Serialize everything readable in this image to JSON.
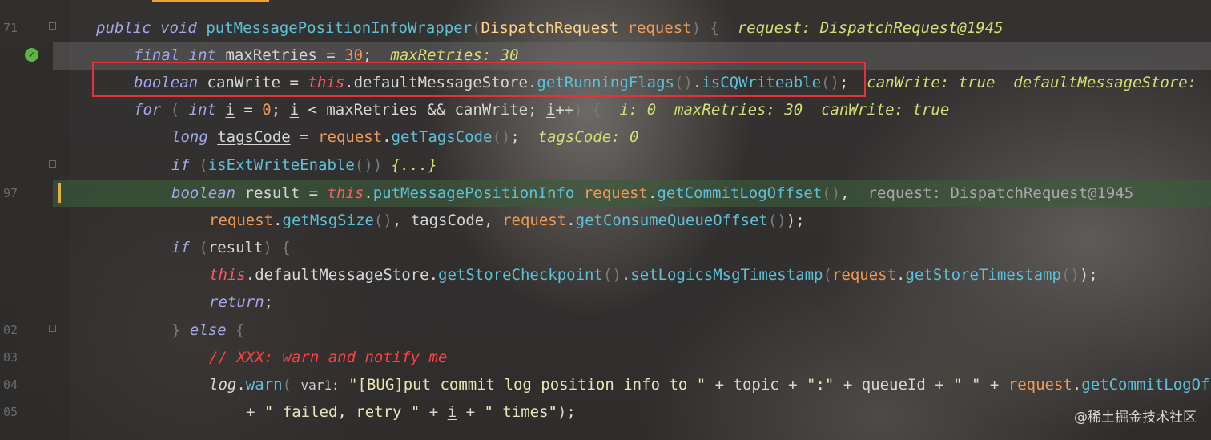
{
  "gutter": {
    "line_numbers": [
      "71",
      "",
      "",
      "",
      "",
      "",
      "97",
      "",
      "",
      "",
      "",
      "02",
      "03",
      "04",
      "05"
    ],
    "line_number_97": "97"
  },
  "code": {
    "l1": {
      "kw1": "public",
      "kw2": "void",
      "method": "putMessagePositionInfoWrapper",
      "paren_open": "(",
      "type": "DispatchRequest",
      "param": "request",
      "paren_close": ")",
      "brace": " {",
      "hint": "request: DispatchRequest@1945"
    },
    "l2": {
      "kw1": "final",
      "kw2": "int",
      "name": "maxRetries",
      "eq": " = ",
      "val": "30",
      "semi": ";",
      "hint": "maxRetries: 30"
    },
    "l3": {
      "kw": "boolean",
      "name": "canWrite",
      "eq": " = ",
      "this": "this",
      "dot1": ".",
      "field": "defaultMessageStore",
      "dot2": ".",
      "m1": "getRunningFlags",
      "p1": "()",
      "dot3": ".",
      "m2": "isCQWriteable",
      "p2": "()",
      "semi": ";",
      "hint": "canWrite: true  defaultMessageStore:"
    },
    "l4": {
      "kw": "for",
      "open": " (",
      "kw2": "int",
      "var": "i",
      "eq": " = ",
      "zero": "0",
      "sep1": "; ",
      "var2": "i",
      "lt": " < maxRetries && canWrite; ",
      "var3": "i",
      "inc": "++",
      "close": ") {",
      "hint": "i: 0  maxRetries: 30  canWrite: true"
    },
    "l5": {
      "kw": "long",
      "name": "tagsCode",
      "eq": " = ",
      "obj": "request",
      "dot": ".",
      "m": "getTagsCode",
      "p": "()",
      "semi": ";",
      "hint": "tagsCode: 0"
    },
    "l6": {
      "kw": "if",
      "open": " (",
      "m": "isExtWriteEnable",
      "p": "()",
      "close": ")",
      "fold": " {...}"
    },
    "l7": {
      "kw": "boolean",
      "name": "result",
      "eq": " = ",
      "this": "this",
      "dot": ".",
      "m": "putMessagePositionInfo",
      "obj": "request",
      "dot2": ".",
      "m2": "getCommitLogOffset",
      "p": "()",
      "comma": ",",
      "hint": "request: DispatchRequest@1945"
    },
    "l8": {
      "obj": "request",
      "dot": ".",
      "m": "getMsgSize",
      "p": "()",
      "comma": ", ",
      "var": "tagsCode",
      "comma2": ", ",
      "obj2": "request",
      "dot2": ".",
      "m2": "getConsumeQueueOffset",
      "p2": "()",
      "close": ");"
    },
    "l9": {
      "kw": "if",
      "open": " (",
      "var": "result",
      "close": ") {"
    },
    "l10": {
      "this": "this",
      "dot": ".",
      "field": "defaultMessageStore",
      "dot2": ".",
      "m1": "getStoreCheckpoint",
      "p1": "()",
      "dot3": ".",
      "m2": "setLogicsMsgTimestamp",
      "open": "(",
      "obj": "request",
      "dot4": ".",
      "m3": "getStoreTimestamp",
      "p3": "()",
      "close": ");"
    },
    "l11": {
      "kw": "return",
      "semi": ";"
    },
    "l12": {
      "brace": "} ",
      "kw": "else",
      "open": " {"
    },
    "l13": {
      "comment": "// XXX: warn and notify me"
    },
    "l14": {
      "obj": "log",
      "dot": ".",
      "m": "warn",
      "open": "(",
      "hint": "var1:",
      "str1": "\"[BUG]put commit log position info to \"",
      "plus1": " + topic + ",
      "str2": "\":\"",
      "plus2": " + queueId + ",
      "str3": "\" \"",
      "plus3": " + ",
      "obj2": "request",
      "dot2": ".",
      "m2": "getCommitLogOff"
    },
    "l15": {
      "plus1": "+ ",
      "str1": "\" failed, retry \"",
      "plus2": " + ",
      "var": "i",
      "plus3": " + ",
      "str2": "\" times\"",
      "close": ");"
    }
  },
  "watermark": "@稀土掘金技术社区",
  "colors": {
    "keyword": "#a3a6e8",
    "method": "#5ec0d8",
    "number": "#ee9a57",
    "string": "#e8e4b8",
    "parameter": "#ee9a57",
    "type": "#ffd28a",
    "comment": "#ff4040",
    "inline_hint": "#d6dd73",
    "highlight_box": "#e0343a",
    "breakpoint_check": "#5fb347",
    "execution_line": "#3c5a3a"
  }
}
